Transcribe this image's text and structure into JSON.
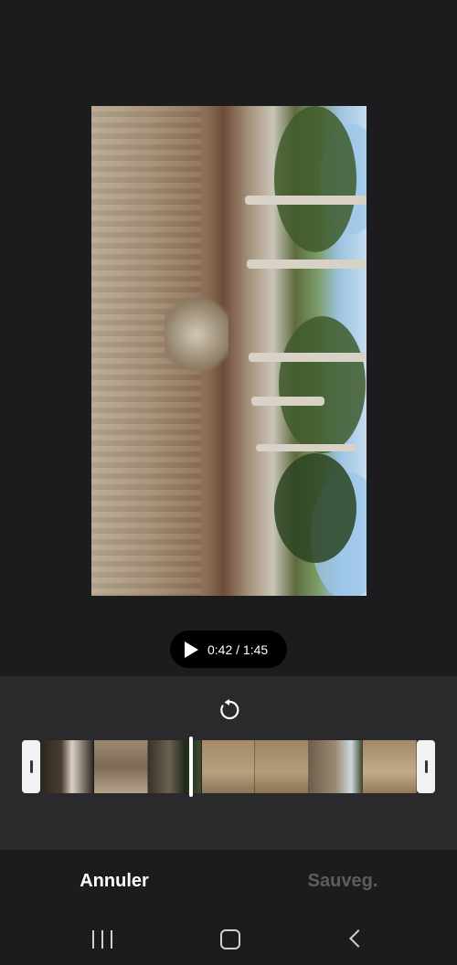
{
  "player": {
    "time_display": "0:42 / 1:45",
    "progress_fraction": 0.4
  },
  "actions": {
    "cancel_label": "Annuler",
    "save_label": "Sauveg."
  },
  "icons": {
    "play": "play-icon",
    "reset": "reset-rotate-icon",
    "recent_apps": "recent-apps-icon",
    "home": "home-icon",
    "back": "back-icon"
  },
  "colors": {
    "background": "#1c1c1e",
    "editor_panel": "#2a2a2c",
    "save_disabled": "#5d5d60",
    "accent": "#ffffff"
  }
}
